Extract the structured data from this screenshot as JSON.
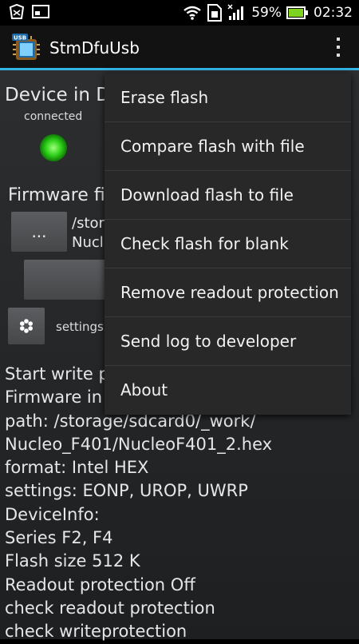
{
  "status_bar": {
    "battery_percent": "59%",
    "time": "02:32",
    "left_icons": [
      "app-notification-icon",
      "screenshot-icon"
    ],
    "right_icons": [
      "wifi-icon",
      "sim-icon",
      "signal-icon",
      "battery-icon"
    ]
  },
  "action_bar": {
    "title": "StmDfuUsb",
    "icon": "usb-chip-icon",
    "overflow_icon": "overflow-menu-icon"
  },
  "main": {
    "device_title": "Device in D",
    "connected_label": "connected",
    "firmware_label": "Firmware fi",
    "browse_button": "...",
    "path_preview": "/stor\nNucl",
    "settings_label": "settings"
  },
  "log_lines": [
    "Start write p",
    "Firmware in",
    "path: /storage/sdcard0/_work/",
    "Nucleo_F401/NucleoF401_2.hex",
    "format: Intel HEX",
    "settings: EONP, UROP, UWRP",
    "DeviceInfo:",
    "Series F2, F4",
    "Flash size 512 K",
    "Readout protection Off",
    "check readout protection",
    "check writeprotection"
  ],
  "menu": {
    "items": [
      "Erase flash",
      "Compare flash with file",
      "Download flash to file",
      "Check flash for blank",
      "Remove readout protection",
      "Send log to developer",
      "About"
    ]
  },
  "colors": {
    "accent": "#33b5e5",
    "led": "#2fd11a",
    "battery": "#7ed321"
  }
}
